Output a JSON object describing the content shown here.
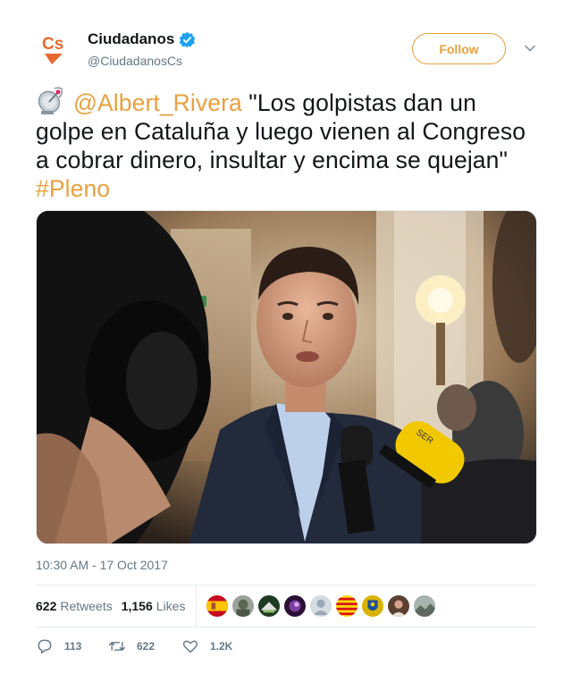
{
  "account": {
    "display_name": "Ciudadanos",
    "handle": "@CiudadanosCs",
    "logo_text": "Cs",
    "brand_color": "#e8a13f"
  },
  "follow_button": {
    "label": "Follow"
  },
  "tweet": {
    "mention": "@Albert_Rivera",
    "text": " \"Los golpistas dan un golpe en Cataluña y luego vienen al Congreso a cobrar dinero, insultar y encima se quejan\" ",
    "hashtag": "#Pleno",
    "emoji_icon": "satellite-antenna-icon"
  },
  "timestamp": "10:30 AM - 17 Oct 2017",
  "stats": {
    "retweets_count": "622",
    "retweets_label": "Retweets",
    "likes_count": "1,156",
    "likes_label": "Likes"
  },
  "liker_avatars": [
    "spain-flag-avatar",
    "soldier-avatar",
    "dark-green-avatar",
    "purple-avatar",
    "default-gray-avatar",
    "catalonia-flag-avatar",
    "coat-of-arms-avatar",
    "person-portrait-avatar",
    "landscape-avatar"
  ],
  "actions": {
    "reply_count": "113",
    "retweet_count": "622",
    "like_count": "1.2K"
  }
}
